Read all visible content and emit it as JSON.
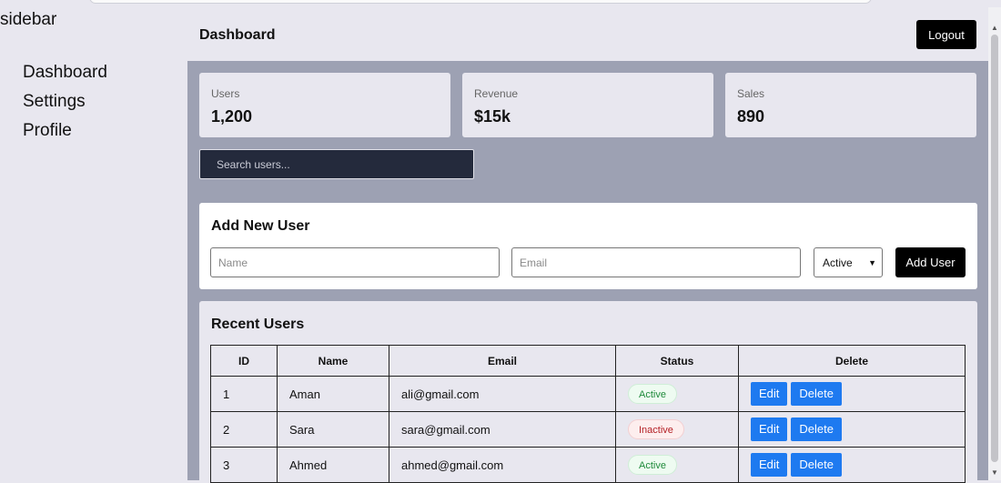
{
  "sidebar": {
    "title": "sidebar",
    "items": [
      {
        "label": "Dashboard"
      },
      {
        "label": "Settings"
      },
      {
        "label": "Profile"
      }
    ]
  },
  "header": {
    "title": "Dashboard",
    "logout_label": "Logout"
  },
  "stats": [
    {
      "label": "Users",
      "value": "1,200"
    },
    {
      "label": "Revenue",
      "value": "$15k"
    },
    {
      "label": "Sales",
      "value": "890"
    }
  ],
  "search": {
    "placeholder": "Search users..."
  },
  "add_user": {
    "title": "Add New User",
    "name_placeholder": "Name",
    "email_placeholder": "Email",
    "status_selected": "Active",
    "submit_label": "Add User"
  },
  "recent_users": {
    "title": "Recent Users",
    "columns": [
      "ID",
      "Name",
      "Email",
      "Status",
      "Delete"
    ],
    "rows": [
      {
        "id": "1",
        "name": "Aman",
        "email": "ali@gmail.com",
        "status": "Active"
      },
      {
        "id": "2",
        "name": "Sara",
        "email": "sara@gmail.com",
        "status": "Inactive"
      },
      {
        "id": "3",
        "name": "Ahmed",
        "email": "ahmed@gmail.com",
        "status": "Active"
      }
    ],
    "edit_label": "Edit",
    "delete_label": "Delete"
  },
  "colors": {
    "primary": "#1e7af0",
    "active_badge": "#1f8a3b",
    "inactive_badge": "#b42025",
    "search_bg": "#242a3c"
  }
}
